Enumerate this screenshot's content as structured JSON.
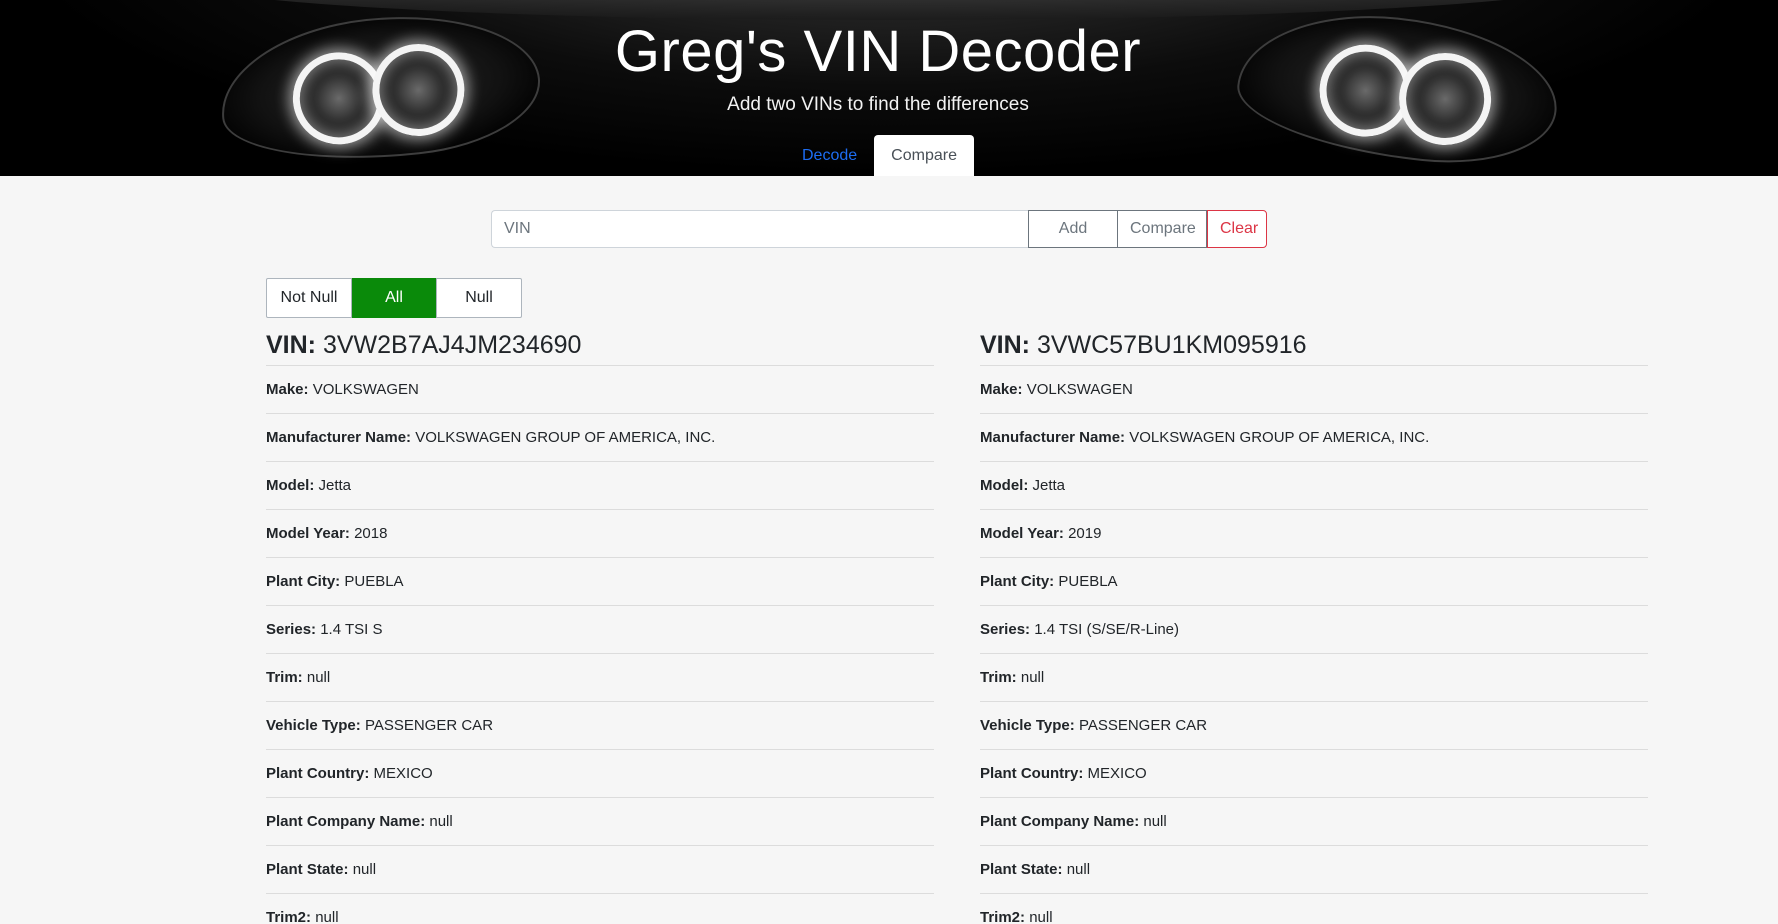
{
  "header": {
    "title": "Greg's VIN Decoder",
    "subtitle": "Add two VINs to find the differences",
    "tabs": [
      {
        "label": "Decode",
        "active": false
      },
      {
        "label": "Compare",
        "active": true
      }
    ]
  },
  "compare_bar": {
    "vin_placeholder": "VIN",
    "vin_value": "",
    "add_label": "Add",
    "compare_label": "Compare",
    "clear_label": "Clear"
  },
  "filter": {
    "options": [
      "Not Null",
      "All",
      "Null"
    ],
    "selected": "All"
  },
  "colors": {
    "accent_link": "#1d6df2",
    "selected_filter": "#0a8a0a",
    "danger": "#dc3545"
  },
  "vehicles": [
    {
      "vin_label": "VIN:",
      "vin": "3VW2B7AJ4JM234690",
      "fields": [
        {
          "key": "Make:",
          "value": "VOLKSWAGEN"
        },
        {
          "key": "Manufacturer Name:",
          "value": "VOLKSWAGEN GROUP OF AMERICA, INC."
        },
        {
          "key": "Model:",
          "value": "Jetta"
        },
        {
          "key": "Model Year:",
          "value": "2018"
        },
        {
          "key": "Plant City:",
          "value": "PUEBLA"
        },
        {
          "key": "Series:",
          "value": "1.4 TSI S"
        },
        {
          "key": "Trim:",
          "value": "null"
        },
        {
          "key": "Vehicle Type:",
          "value": "PASSENGER CAR"
        },
        {
          "key": "Plant Country:",
          "value": "MEXICO"
        },
        {
          "key": "Plant Company Name:",
          "value": "null"
        },
        {
          "key": "Plant State:",
          "value": "null"
        },
        {
          "key": "Trim2:",
          "value": "null"
        }
      ]
    },
    {
      "vin_label": "VIN:",
      "vin": "3VWC57BU1KM095916",
      "fields": [
        {
          "key": "Make:",
          "value": "VOLKSWAGEN"
        },
        {
          "key": "Manufacturer Name:",
          "value": "VOLKSWAGEN GROUP OF AMERICA, INC."
        },
        {
          "key": "Model:",
          "value": "Jetta"
        },
        {
          "key": "Model Year:",
          "value": "2019"
        },
        {
          "key": "Plant City:",
          "value": "PUEBLA"
        },
        {
          "key": "Series:",
          "value": "1.4 TSI (S/SE/R-Line)"
        },
        {
          "key": "Trim:",
          "value": "null"
        },
        {
          "key": "Vehicle Type:",
          "value": "PASSENGER CAR"
        },
        {
          "key": "Plant Country:",
          "value": "MEXICO"
        },
        {
          "key": "Plant Company Name:",
          "value": "null"
        },
        {
          "key": "Plant State:",
          "value": "null"
        },
        {
          "key": "Trim2:",
          "value": "null"
        }
      ]
    }
  ]
}
